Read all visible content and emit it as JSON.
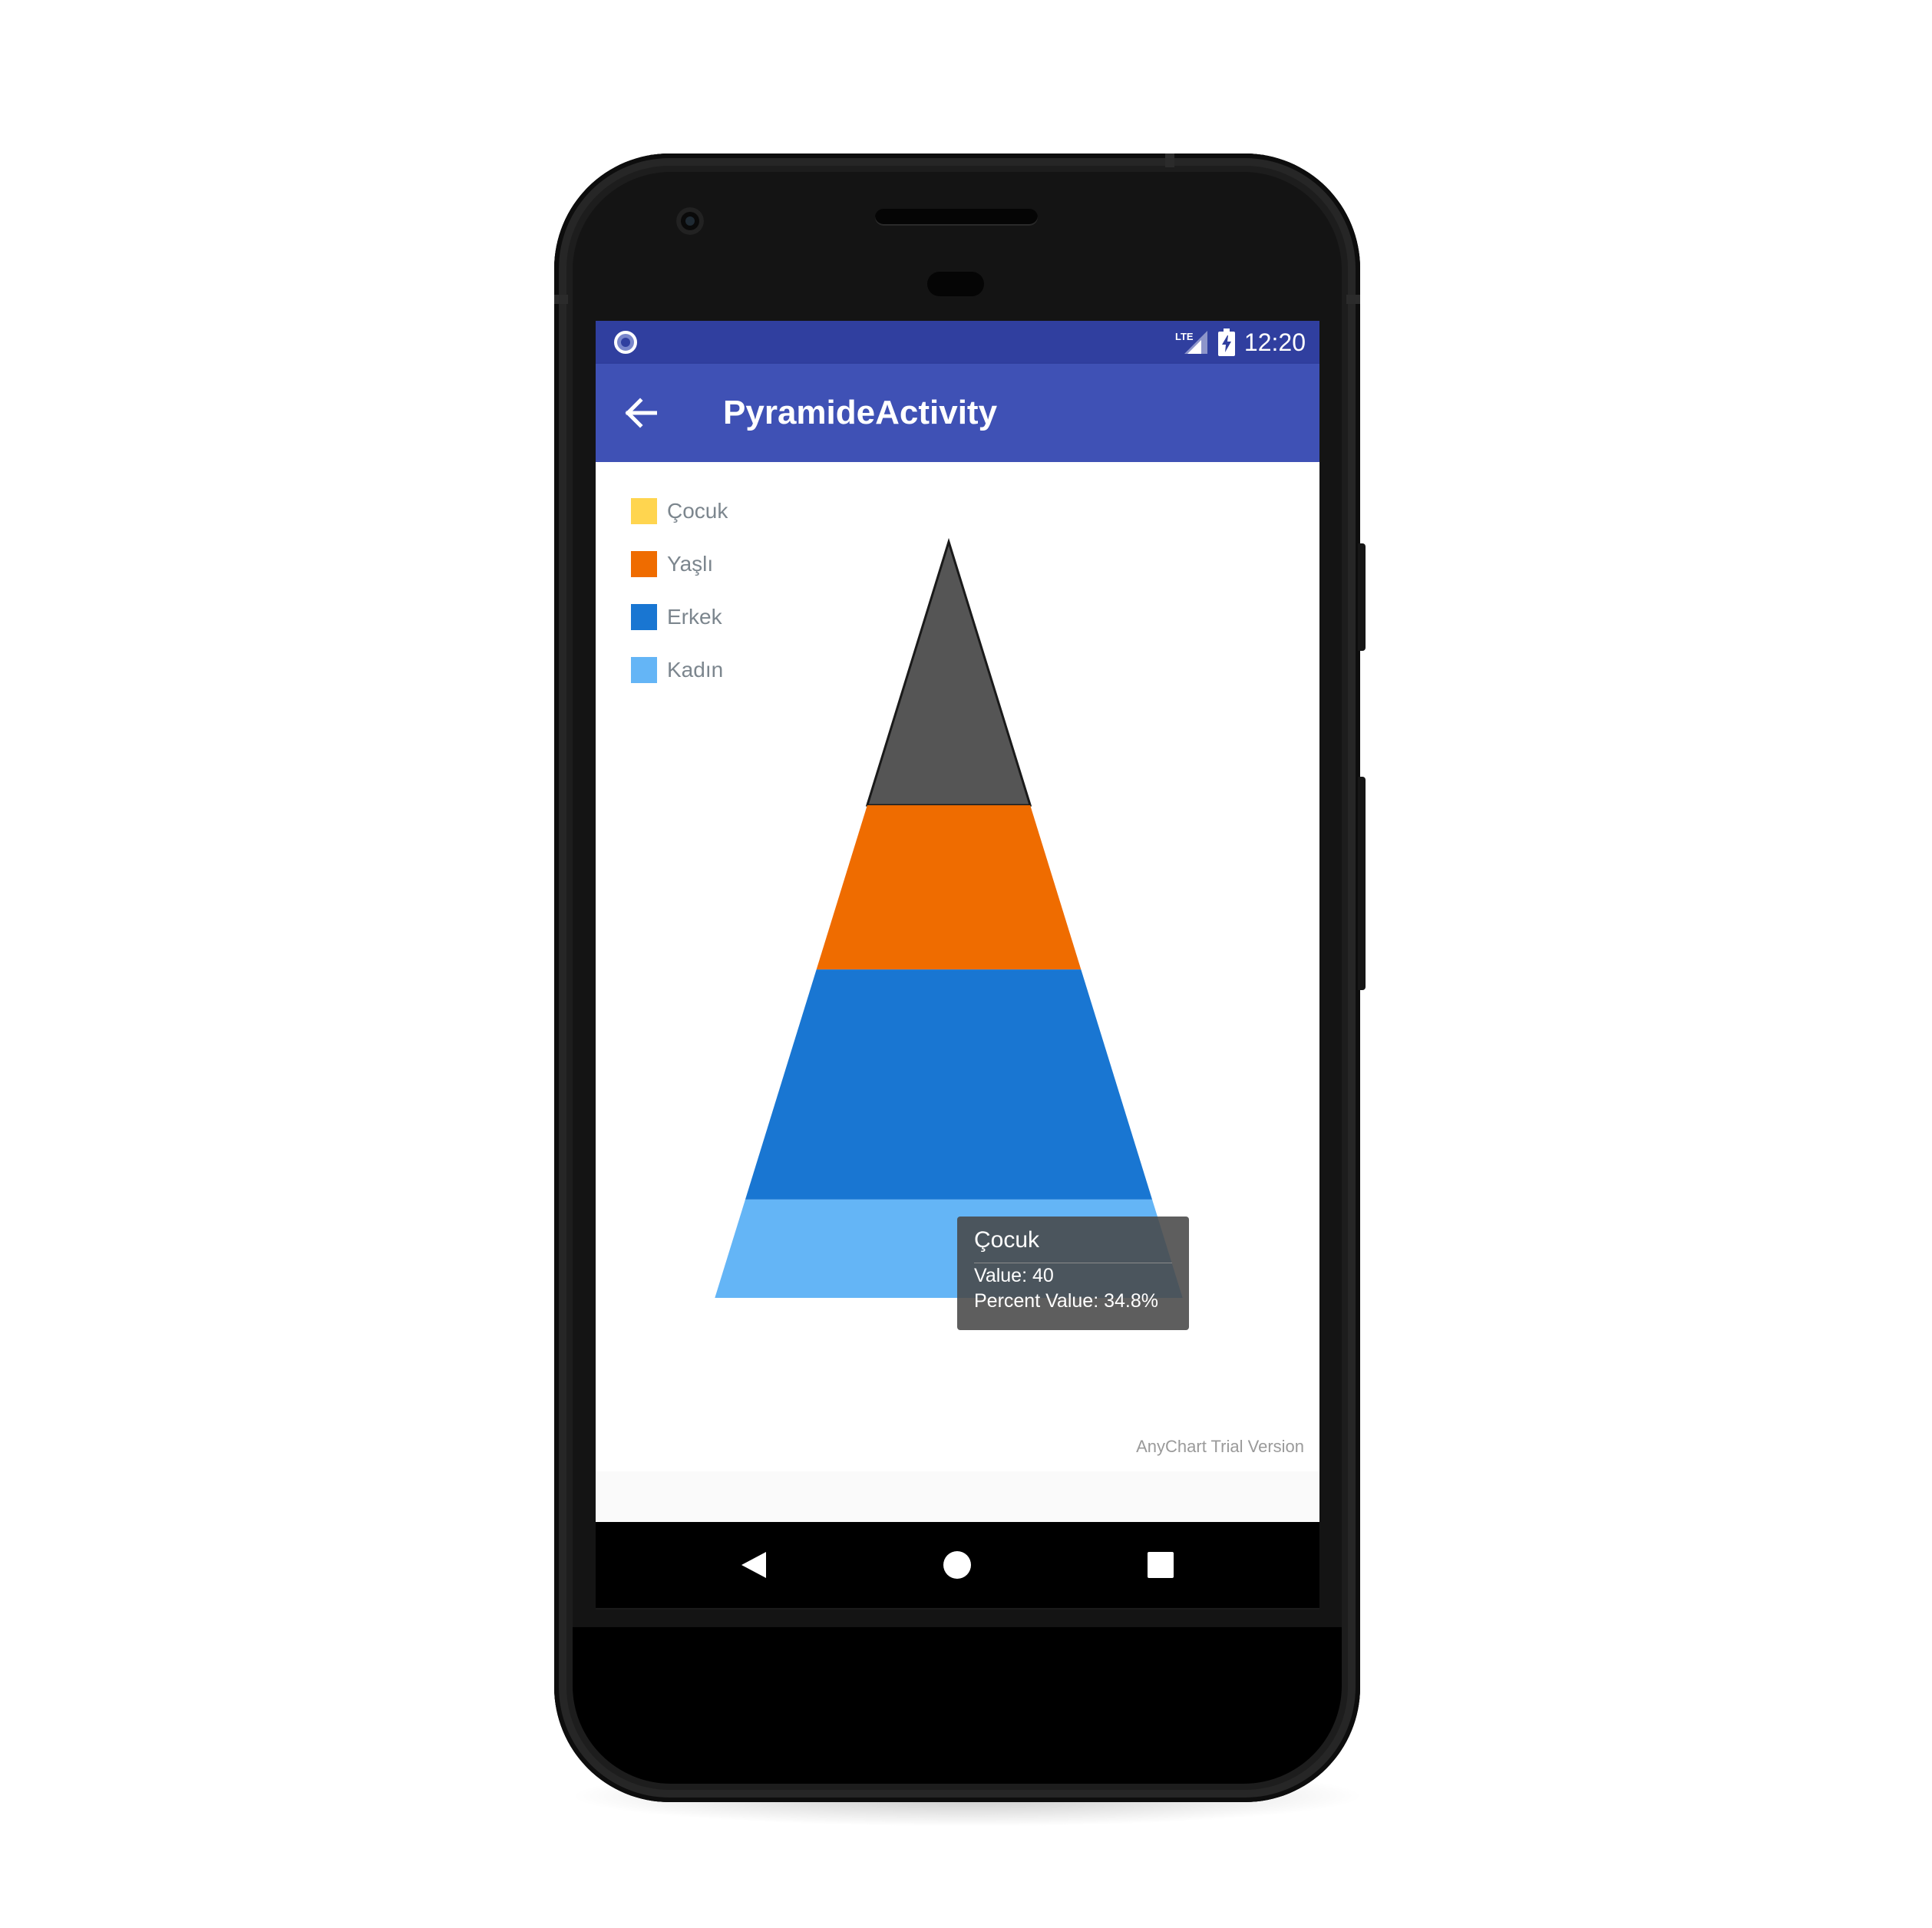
{
  "status_bar": {
    "time": "12:20",
    "network_label": "LTE",
    "icons": [
      "notification-circle-icon",
      "lte-signal-icon",
      "battery-charging-icon"
    ]
  },
  "app_bar": {
    "title": "PyramideActivity",
    "back_icon": "arrow-left-icon"
  },
  "chart_data": {
    "type": "pyramid",
    "legend": [
      {
        "label": "Çocuk",
        "color": "#ffd54f"
      },
      {
        "label": "Yaşlı",
        "color": "#ef6c00"
      },
      {
        "label": "Erkek",
        "color": "#1976d2"
      },
      {
        "label": "Kadın",
        "color": "#64b5f6"
      }
    ],
    "segments": [
      {
        "name": "Çocuk",
        "color": "#555555",
        "hovered": true,
        "share": 0.348
      },
      {
        "name": "Yaşlı",
        "color": "#ef6c00",
        "share": 0.217
      },
      {
        "name": "Erkek",
        "color": "#1976d2",
        "share": 0.304
      },
      {
        "name": "Kadın",
        "color": "#64b5f6",
        "share": 0.13
      }
    ],
    "tooltip": {
      "title": "Çocuk",
      "value_line": "Value: 40",
      "percent_line": "Percent Value: 34.8%"
    },
    "watermark": "AnyChart Trial Version"
  },
  "nav_bar": {
    "buttons": [
      "back-triangle-icon",
      "home-circle-icon",
      "recents-square-icon"
    ]
  }
}
